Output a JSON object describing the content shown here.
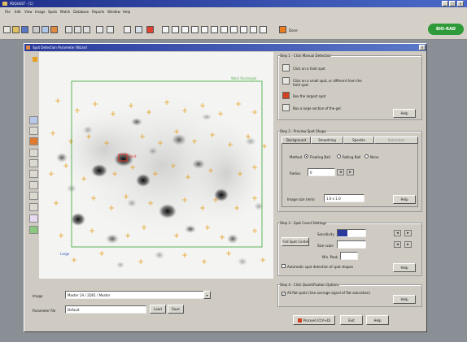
{
  "app": {
    "title": "PDQUEST - [1]",
    "menu": [
      "File",
      "Edit",
      "View",
      "Image",
      "Spots",
      "Match",
      "Database",
      "Reports",
      "Window",
      "Help"
    ],
    "toolbar_right_label": "Done",
    "brand": "BIO-RAD"
  },
  "wizard": {
    "title": "Spot Detection Parameter Wizard",
    "image_label": "Image",
    "image_value": "Master 1A / 2D01 / Master",
    "param_file_label": "Parameter file",
    "param_file_value": "Default",
    "load_label": "Load",
    "save_label": "Save",
    "green_box_label": "Work Rectangle",
    "spot_faint_label": "Faint",
    "spot_large_label": "Large",
    "step1": {
      "title": "Step 1 - Click Manual Detection",
      "faint_label": "Click on a faint spot",
      "small_label": "Click on a small spot, or different from the faint spot",
      "large_label": "Box the largest spot",
      "region_label": "Box a large section of the gel",
      "help": "Help"
    },
    "step2": {
      "title": "Step 2 - Preview Spot Shape",
      "tabs": [
        "Background",
        "Smoothing",
        "Speckle",
        "Saturation"
      ],
      "method_label": "Method",
      "methods": [
        "Floating Ball",
        "Rolling Ball",
        "None"
      ],
      "radius_label": "Radius",
      "radius_value": "6",
      "image_size_label": "Image size (mm)",
      "image_size_value": "1.0 x 1.0",
      "help": "Help"
    },
    "step3": {
      "title": "Step 3 - Spot Count Settings",
      "find_button": "Find Spot Center",
      "sensitivity_label": "Sensitivity",
      "sensitivity_value": "",
      "size_scale_label": "Size scale",
      "size_scale_value": "",
      "min_peak_label": "Min. Peak",
      "min_peak_value": "",
      "checkbox_label": "Automatic spot detection of spot shapes",
      "help": "Help"
    },
    "step4": {
      "title": "Step 4 - Click Quantification Options",
      "checkbox_label": "All flat spots (Use average signal of flat saturation)",
      "help": "Help"
    },
    "footer": {
      "proceed": "Proceed (Ctrl+D)",
      "exit": "Exit",
      "help": "Help"
    }
  },
  "colors": {
    "titlebar": "#2a3a9c",
    "panel": "#cfcbc3",
    "green_box": "#5bb35a",
    "spot_marker": "#e6a020",
    "selected_spot": "#e03020",
    "brand_bg": "#2f9a3a"
  }
}
